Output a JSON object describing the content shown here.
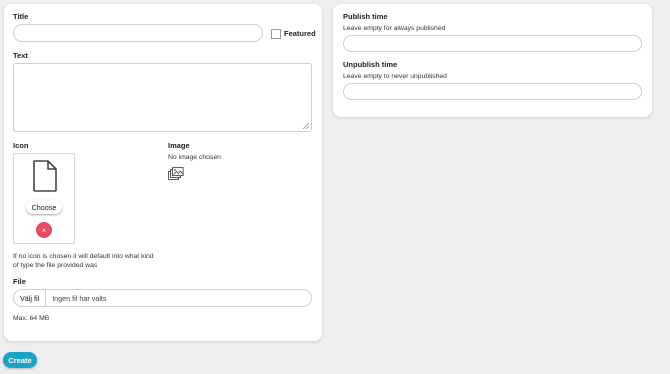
{
  "form": {
    "title_label": "Title",
    "featured_label": "Featured",
    "text_label": "Text",
    "icon_label": "Icon",
    "choose_label": "Choose",
    "remove_glyph": "×",
    "image_label": "Image",
    "no_image_text": "No image chosen",
    "icon_hint_line1": "If no icon is chosen it will default into what kind",
    "icon_hint_line2": "of type the file provided was",
    "file_label": "File",
    "file_button_label": "Välj fil",
    "file_status": "Ingen fil har valts",
    "max_size": "Max: 64 MB"
  },
  "schedule": {
    "publish_label": "Publish time",
    "publish_hint": "Leave empty for always published",
    "unpublish_label": "Unpublish time",
    "unpublish_hint": "Leave empty to never unpublished"
  },
  "actions": {
    "create_label": "Create"
  },
  "colors": {
    "create_button": "#1ba3c6",
    "remove_button": "#e84a5f"
  },
  "icons": [
    "document-icon",
    "image-gallery-icon",
    "close-icon",
    "resize-grip-icon"
  ]
}
